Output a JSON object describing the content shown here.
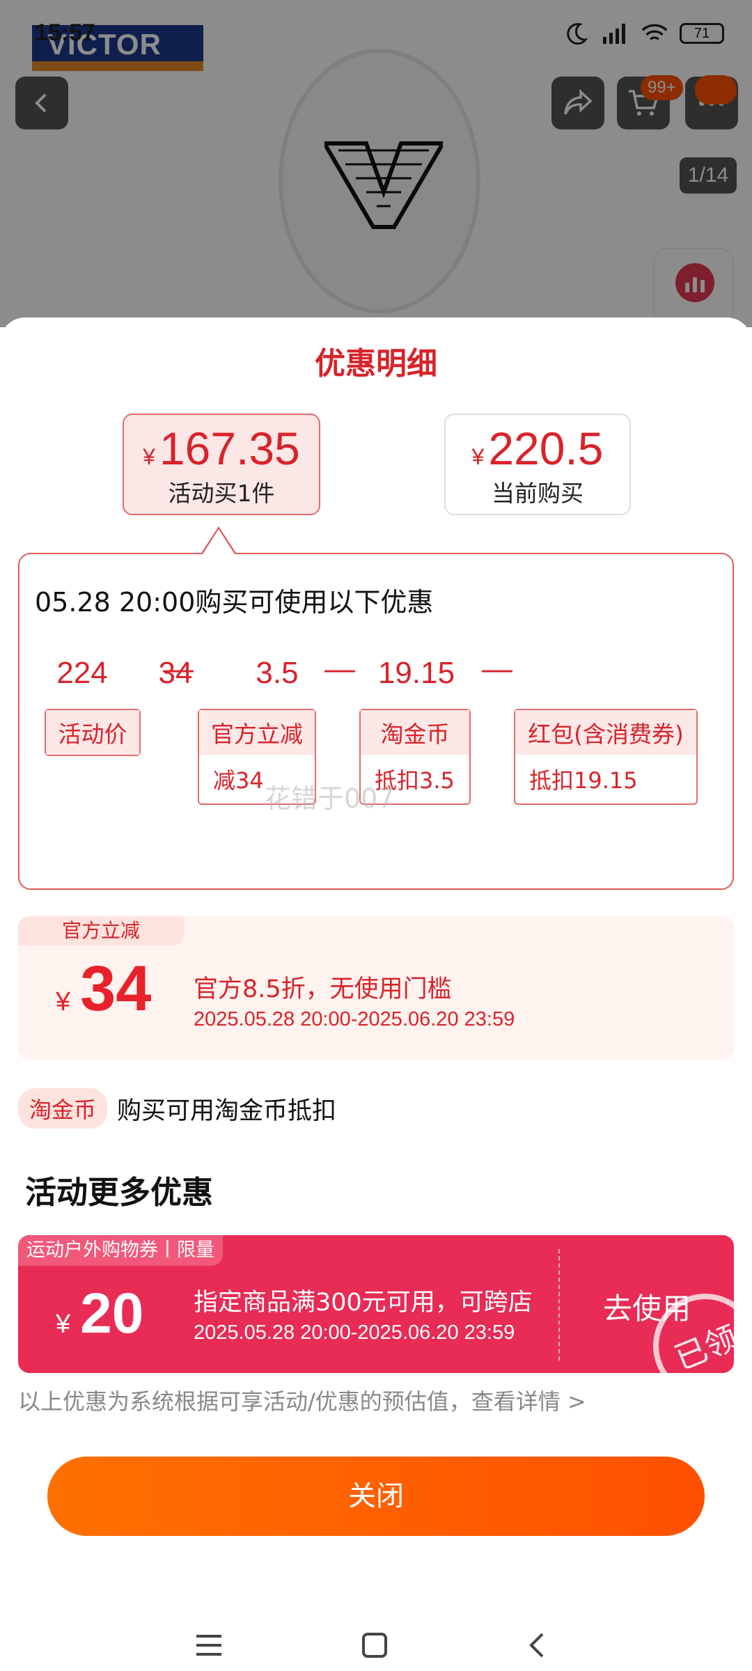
{
  "status_bar": {
    "time": "15:57",
    "battery": "71"
  },
  "product_header": {
    "brand": "VICTOR",
    "cart_badge": "99+",
    "image_counter": "1/14"
  },
  "sheet": {
    "title": "优惠明细",
    "price_options": [
      {
        "currency": "¥",
        "amount": "167.35",
        "label": "活动买1件"
      },
      {
        "currency": "¥",
        "amount": "220.5",
        "label": "当前购买"
      }
    ],
    "detail": {
      "heading": "05.28 20:00购买可使用以下优惠",
      "numbers": [
        "224",
        "34",
        "3.5",
        "19.15"
      ],
      "operator": "—",
      "items": [
        {
          "title": "活动价",
          "sub": ""
        },
        {
          "title": "官方立减",
          "sub": "减34"
        },
        {
          "title": "淘金币",
          "sub": "抵扣3.5"
        },
        {
          "title": "红包(含消费券)",
          "sub": "抵扣19.15"
        }
      ],
      "watermark": "花错于007"
    },
    "official": {
      "tag": "官方立减",
      "currency": "¥",
      "amount": "34",
      "desc": "官方8.5折，无使用门槛",
      "date": "2025.05.28 20:00-2025.06.20 23:59"
    },
    "coin": {
      "tag": "淘金币",
      "text": "购买可用淘金币抵扣"
    },
    "more_title": "活动更多优惠",
    "coupon": {
      "tag": "运动户外购物券丨限量",
      "currency": "¥",
      "amount": "20",
      "desc": "指定商品满300元可用，可跨店",
      "date": "2025.05.28 20:00-2025.06.20 23:59",
      "action": "去使用",
      "stamp": "已领"
    },
    "note": "以上优惠为系统根据可享活动/优惠的预估值，查看详情 >",
    "close_button": "关闭"
  },
  "colors": {
    "accent": "#d8232a",
    "coupon": "#e82c55",
    "close": "#ff5000"
  },
  "icons": [
    "back-icon",
    "share-icon",
    "cart-icon",
    "more-icon",
    "chart-icon",
    "menu-icon",
    "home-icon",
    "back-nav-icon"
  ]
}
